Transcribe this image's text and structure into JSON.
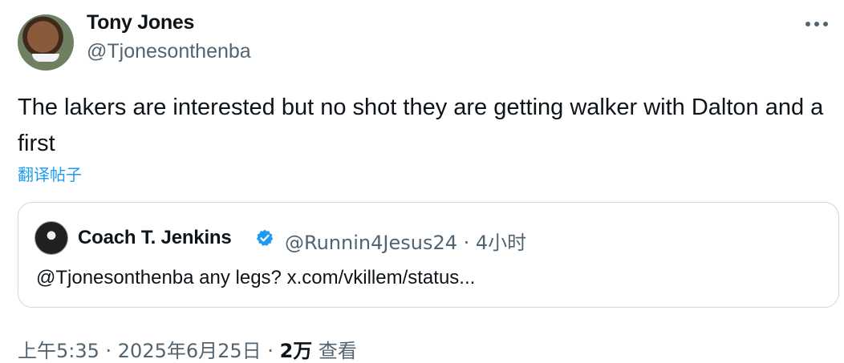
{
  "author": {
    "name": "Tony Jones",
    "handle": "@Tjonesonthenba",
    "avatar_icon": "profile-photo"
  },
  "tweet": {
    "text": "The lakers are interested but no shot they are getting walker with Dalton and a first",
    "translate_label": "翻译帖子"
  },
  "quote": {
    "name": "Coach T. Jenkins",
    "verified": true,
    "handle_time": "@Runnin4Jesus24 · 4小时",
    "text": "@Tjonesonthenba any legs? x.com/vkillem/status..."
  },
  "meta": {
    "timestamp": "上午5:35 · 2025年6月25日 · ",
    "views_count": "2万",
    "views_label": " 查看"
  },
  "colors": {
    "accent": "#1d9bf0",
    "muted": "#536471",
    "text": "#0f1419",
    "border": "#cfd9de"
  }
}
